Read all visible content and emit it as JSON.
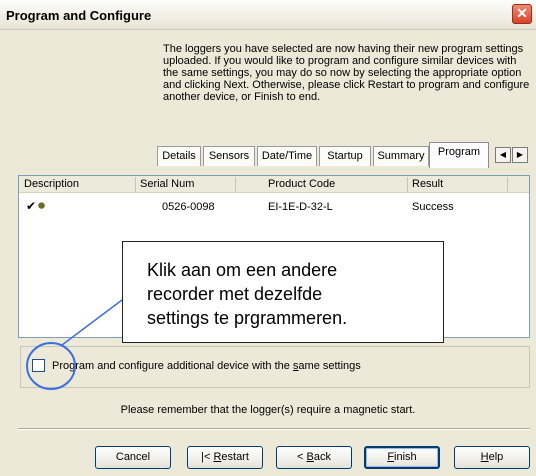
{
  "window": {
    "title": "Program and Configure",
    "close_glyph": "✕"
  },
  "intro_text": "The loggers you have selected are now having their new program settings uploaded. If you would like to program and configure similar devices with the same settings, you may do so now by selecting the appropriate option and clicking Next. Otherwise, please click Restart to program and configure another device, or Finish to end.",
  "tabs": [
    {
      "label": "Details"
    },
    {
      "label": "Sensors"
    },
    {
      "label": "Date/Time"
    },
    {
      "label": "Startup"
    },
    {
      "label": "Summary"
    },
    {
      "label": "Program",
      "active": true
    }
  ],
  "tab_scroll": {
    "left": "◀",
    "right": "▶"
  },
  "list": {
    "columns": [
      "Description",
      "Serial Num",
      "Product Code",
      "Result"
    ],
    "rows": [
      {
        "description_icon": "checkmark-logger-icon",
        "check_glyph": "✔",
        "logger_glyph": "⏺",
        "serial": "0526-0098",
        "product": "EI-1E-D-32-L",
        "result": "Success"
      }
    ]
  },
  "option": {
    "checked": false,
    "label_prefix": "Program and configure additional device with the ",
    "label_underlined": "s",
    "label_suffix": "ame settings"
  },
  "notice": "Please remember that the logger(s) require a magnetic start.",
  "buttons": {
    "cancel": "Cancel",
    "restart_prefix": "|< ",
    "restart_u": "R",
    "restart_rest": "estart",
    "back_prefix": "< ",
    "back_u": "B",
    "back_rest": "ack",
    "finish_u": "F",
    "finish_rest": "inish",
    "help_u": "H",
    "help_rest": "elp"
  },
  "callout": {
    "line1": "Klik aan om een andere",
    "line2": "recorder met dezelfde",
    "line3": "settings te prgrammeren."
  },
  "colors": {
    "annotation_circle": "#3a6fe0",
    "title_close": "#d6432a"
  }
}
